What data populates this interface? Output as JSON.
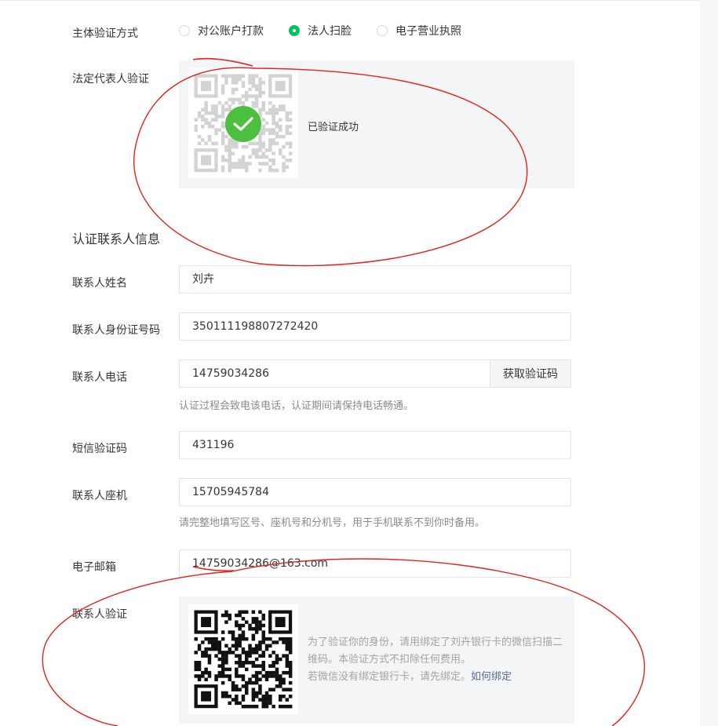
{
  "subject_verify": {
    "label": "主体验证方式",
    "options": [
      {
        "label": "对公账户打款",
        "checked": false
      },
      {
        "label": "法人扫脸",
        "checked": true
      },
      {
        "label": "电子营业执照",
        "checked": false
      }
    ]
  },
  "legal_rep": {
    "label": "法定代表人验证",
    "status_text": "已验证成功"
  },
  "contact_section": {
    "title": "认证联系人信息"
  },
  "fields": {
    "name": {
      "label": "联系人姓名",
      "value": "刘卉"
    },
    "id_number": {
      "label": "联系人身份证号码",
      "value": "350111198807272420"
    },
    "phone": {
      "label": "联系人电话",
      "value": "14759034286",
      "button": "获取验证码",
      "hint": "认证过程会致电该电话，认证期间请保持电话畅通。"
    },
    "sms_code": {
      "label": "短信验证码",
      "value": "431196"
    },
    "landline": {
      "label": "联系人座机",
      "value": "15705945784",
      "hint": "请完整地填写区号、座机号和分机号，用于手机联系不到你时备用。"
    },
    "email": {
      "label": "电子邮箱",
      "value": "14759034286@163.com"
    }
  },
  "contact_verify": {
    "label": "联系人验证",
    "desc_line1": "为了验证你的身份，请用绑定了刘卉银行卡的微信扫描二维码。本验证方式不扣除任何费用。",
    "desc_line2": "若微信没有绑定银行卡，请先绑定。",
    "link": "如何绑定"
  },
  "colors": {
    "accent_green": "#07c160",
    "success_green": "#4cbf3f",
    "link_blue": "#576b95",
    "annotation_red": "#e0231c"
  }
}
